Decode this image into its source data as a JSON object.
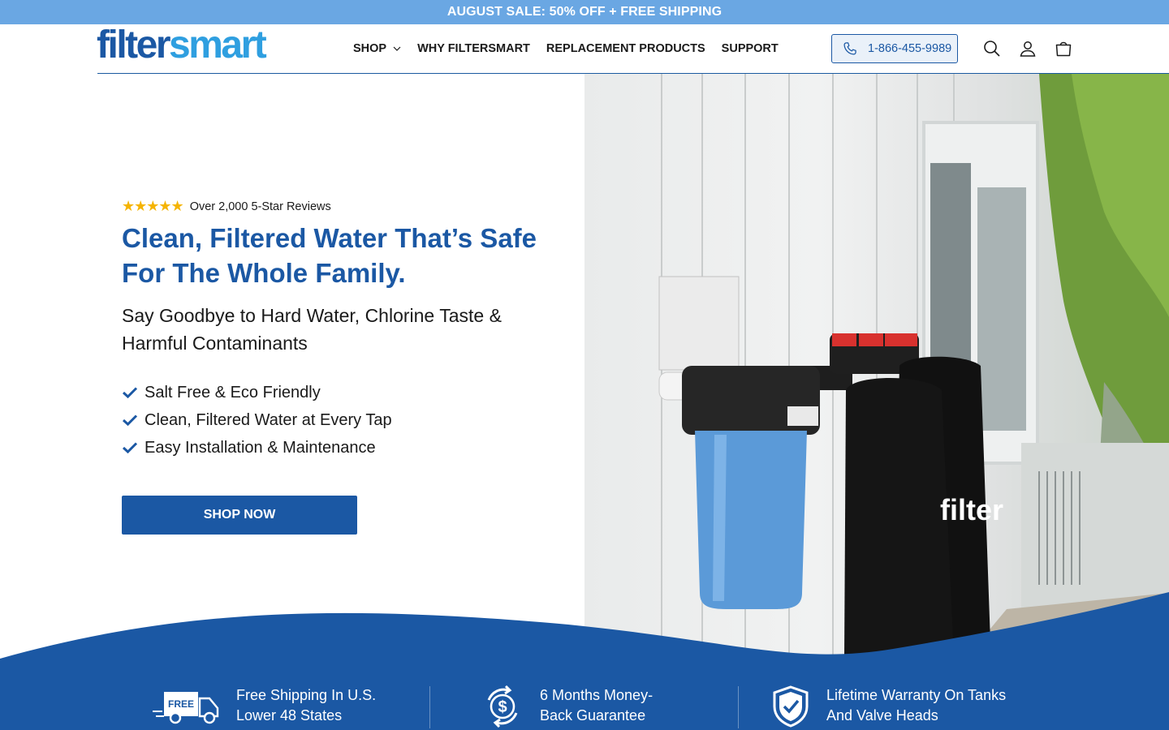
{
  "announcement": "AUGUST SALE: 50% OFF + FREE SHIPPING",
  "logo": {
    "part1": "filter",
    "part2": "smart"
  },
  "nav": [
    {
      "label": "SHOP",
      "has_dropdown": true
    },
    {
      "label": "WHY FILTERSMART"
    },
    {
      "label": "REPLACEMENT PRODUCTS"
    },
    {
      "label": "SUPPORT"
    }
  ],
  "phone": "1-866-455-9989",
  "header_icons": [
    "search-icon",
    "account-icon",
    "cart-icon"
  ],
  "hero": {
    "stars": "★★★★★",
    "rating_text": "Over 2,000 5-Star Reviews",
    "headline": "Clean, Filtered Water That’s Safe For The Whole Family.",
    "subheadline": "Say Goodbye to Hard Water, Chlorine Taste & Harmful Contaminants",
    "bullets": [
      "Salt Free & Eco Friendly",
      "Clean, Filtered Water at Every Tap",
      "Easy Installation & Maintenance"
    ],
    "cta": "SHOP NOW",
    "image_tank_brand": "filter"
  },
  "features": [
    {
      "icon": "free-shipping-truck-icon",
      "badge": "FREE",
      "line1": "Free Shipping In U.S.",
      "line2": "Lower 48 States"
    },
    {
      "icon": "money-back-icon",
      "line1": "6 Months Money-",
      "line2": "Back Guarantee"
    },
    {
      "icon": "warranty-shield-icon",
      "line1": "Lifetime Warranty On Tanks",
      "line2": "And Valve Heads"
    }
  ],
  "colors": {
    "brand_dark": "#1b58a4",
    "brand_light": "#2f9fe0",
    "announcement_bg": "#6aa7e3",
    "star": "#f5b400"
  }
}
